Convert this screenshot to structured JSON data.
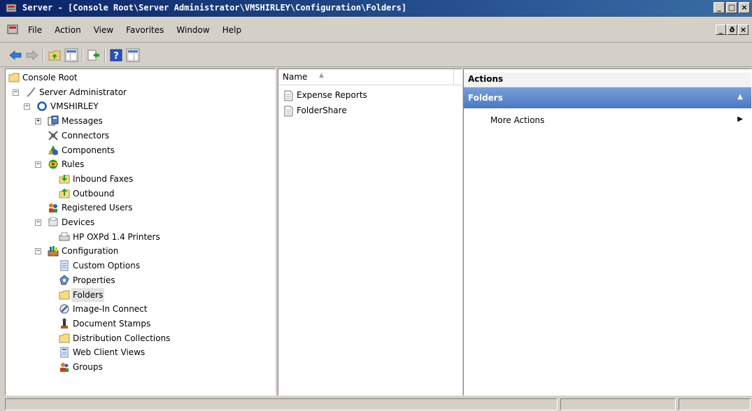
{
  "window": {
    "title": "Server - [Console Root\\Server Administrator\\VMSHIRLEY\\Configuration\\Folders]",
    "min_glyph": "_",
    "max_glyph": "□",
    "close_glyph": "×"
  },
  "menu": {
    "items": [
      "File",
      "Action",
      "View",
      "Favorites",
      "Window",
      "Help"
    ],
    "mdi_min_glyph": "_",
    "mdi_restore_glyph": "ð",
    "mdi_close_glyph": "×"
  },
  "toolbar": {
    "buttons": [
      "back-icon",
      "forward-icon",
      "up-folder-icon",
      "show-hide-tree-icon",
      "export-list-icon",
      "help-icon",
      "show-hide-action-pane-icon"
    ]
  },
  "tree": {
    "items": [
      {
        "label": "Console Root",
        "icon": "folder-icon",
        "expander": ""
      },
      {
        "label": "Server Administrator",
        "icon": "snapin-icon",
        "expander": "−"
      },
      {
        "label": "VMSHIRLEY",
        "icon": "server-icon",
        "expander": "−"
      },
      {
        "label": "Messages",
        "icon": "messages-icon",
        "expander": "+"
      },
      {
        "label": "Connectors",
        "icon": "connectors-icon",
        "expander": ""
      },
      {
        "label": "Components",
        "icon": "components-icon",
        "expander": ""
      },
      {
        "label": "Rules",
        "icon": "rules-icon",
        "expander": "−"
      },
      {
        "label": "Inbound Faxes",
        "icon": "inbound-rule-icon",
        "expander": ""
      },
      {
        "label": "Outbound",
        "icon": "outbound-rule-icon",
        "expander": ""
      },
      {
        "label": "Registered Users",
        "icon": "users-icon",
        "expander": ""
      },
      {
        "label": "Devices",
        "icon": "devices-icon",
        "expander": "−"
      },
      {
        "label": "HP OXPd 1.4 Printers",
        "icon": "printer-icon",
        "expander": ""
      },
      {
        "label": "Configuration",
        "icon": "configuration-icon",
        "expander": "−"
      },
      {
        "label": "Custom Options",
        "icon": "custom-options-icon",
        "expander": ""
      },
      {
        "label": "Properties",
        "icon": "properties-icon",
        "expander": ""
      },
      {
        "label": "Folders",
        "icon": "folder-icon",
        "expander": "",
        "selected": true
      },
      {
        "label": "Image-In Connect",
        "icon": "image-in-connect-icon",
        "expander": ""
      },
      {
        "label": "Document Stamps",
        "icon": "document-stamps-icon",
        "expander": ""
      },
      {
        "label": "Distribution Collections",
        "icon": "distribution-collections-icon",
        "expander": ""
      },
      {
        "label": "Web Client Views",
        "icon": "web-client-views-icon",
        "expander": ""
      },
      {
        "label": "Groups",
        "icon": "groups-icon",
        "expander": ""
      }
    ]
  },
  "list": {
    "column_header": "Name",
    "sort_glyph": "▲",
    "items": [
      {
        "label": "Expense Reports",
        "icon": "document-icon"
      },
      {
        "label": "FolderShare",
        "icon": "document-icon"
      }
    ]
  },
  "actions": {
    "header": "Actions",
    "section_title": "Folders",
    "section_caret": "▲",
    "items": [
      {
        "label": "More Actions",
        "arrow": "▶"
      }
    ]
  },
  "colors": {
    "title_bar": "#0a246a",
    "action_section": "#4b78c2",
    "chrome": "#d4d0c8"
  }
}
